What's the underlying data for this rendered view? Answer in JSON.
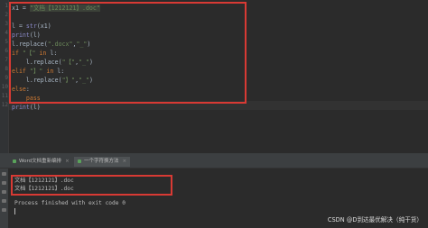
{
  "editor": {
    "line_numbers": [
      "1",
      "2",
      "3",
      "4",
      "5",
      "6",
      "7",
      "8",
      "9",
      "10",
      "11",
      "12",
      "13",
      "14"
    ],
    "lines": [
      {
        "a": "x1 = ",
        "b": "\"文档【1212121】.doc\""
      },
      {
        "a": "",
        "b": ""
      },
      {
        "a": "l = ",
        "f": "str",
        "c": "(x1)"
      },
      {
        "a": "",
        "f": "print",
        "c": "(l)"
      },
      {
        "a": "l.replace(",
        "s": "\".docx\"",
        "c": ",",
        "s2": "\"_\"",
        "d": ")"
      },
      {
        "k": "if ",
        "s": "\"【\"",
        "k2": " in ",
        "c": "l:"
      },
      {
        "a": "    l.replace(",
        "s": "\"【\"",
        "c": ",",
        "s2": "\"_\"",
        "d": ")"
      },
      {
        "k": "elif ",
        "s": "\"】\"",
        "k2": " in ",
        "c": "l:"
      },
      {
        "a": "    l.replace(",
        "s": "\"】\"",
        "c": ",",
        "s2": "\"_\"",
        "d": ")"
      },
      {
        "k": "else",
        "c": ":"
      },
      {
        "k": "    pass",
        "c": ""
      },
      {
        "a": "",
        "f": "print",
        "c": "(l)"
      }
    ]
  },
  "run_tabs": [
    {
      "label": "Word文档重新编排",
      "active": false
    },
    {
      "label": "一个字符换方法",
      "active": true
    }
  ],
  "output": {
    "lines": [
      "文档【1212121】.doc",
      "文档【1212121】.doc",
      "",
      "Process finished with exit code 0"
    ]
  },
  "watermark": "CSDN @D到达最优解决（纯干货）",
  "colors": {
    "highlight_border": "#d83a34",
    "background": "#2b2b2b",
    "keyword": "#cc7832",
    "string": "#6a8759",
    "builtin": "#8888c6"
  }
}
